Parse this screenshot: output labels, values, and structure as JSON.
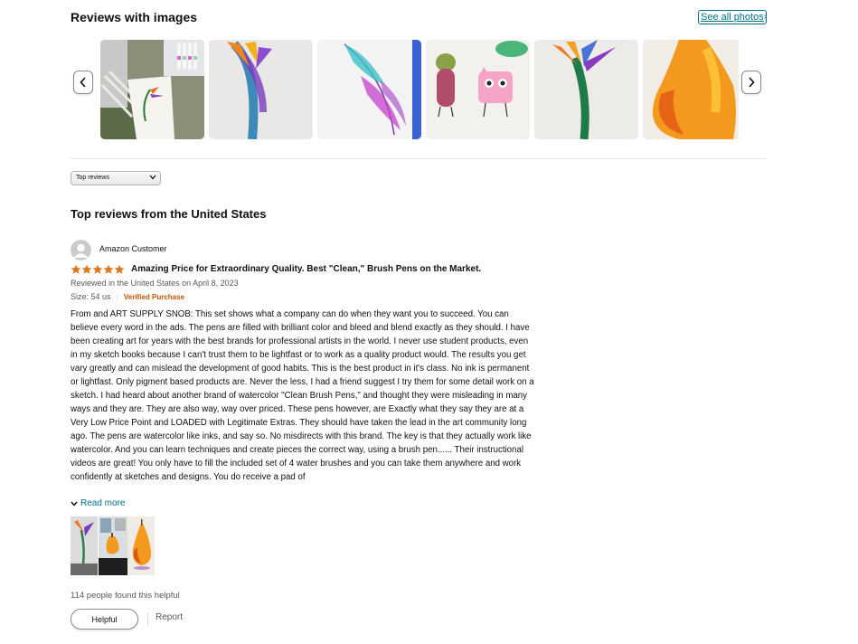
{
  "images_section": {
    "title": "Reviews with images",
    "see_all_label": "See all photos",
    "thumbnails": [
      {
        "icon": "art-supplies-photo"
      },
      {
        "icon": "bird-of-paradise-painting"
      },
      {
        "icon": "feather-painting"
      },
      {
        "icon": "cartoon-characters-drawing"
      },
      {
        "icon": "bird-of-paradise-painting"
      },
      {
        "icon": "pear-painting"
      }
    ]
  },
  "sort": {
    "selected": "Top reviews"
  },
  "reviews_heading": "Top reviews from the United States",
  "review": {
    "reviewer": "Amazon Customer",
    "rating": 5,
    "title": "Amazing Price for Extraordinary Quality. Best \"Clean,\" Brush Pens on the Market.",
    "reviewed_in": "Reviewed in the United States on April 8, 2023",
    "size": "Size: 54 us",
    "verified": "Verified Purchase",
    "body": "From and ART SUPPLY SNOB: This set shows what a company can do when they want you to succeed. You can believe every word in the ads. The pens are filled with brilliant color and bleed and blend exactly as they should. I have been creating art for years with the best brands for professional artists in the world. I never use student products, even in my sketch books because I can't trust them to be lightfast or to work as a quality product would. The results you get vary greatly and can mislead the development of good habits. This is the best product in it's class. No ink is permanent or lightfast. Only pigment based products are. Never the less, I had a friend suggest I try them for some detail work on a sketch. I had heard about another brand of watercolor \"Clean Brush Pens,\" and thought they were misleading in many ways and they are. They are also way, way over priced. These pens however, are Exactly what they say they are at a Very Low Price Point and LOADED with Legitimate Extras. They should have taken the lead in the art community long ago. The pens are watercolor like inks, and say so. No misdirects with this brand. The key is that they actually work like watercolor. And you can learn techniques and create pieces the correct way, using a brush pen...... Their instructional videos are great! You only have to fill the included set of 4 water brushes and you can take them anywhere and work confidently at sketches and designs. You do receive a pad of",
    "read_more": "Read more",
    "images": [
      {
        "icon": "bird-of-paradise-painting"
      },
      {
        "icon": "pear-in-progress-photo"
      },
      {
        "icon": "pear-painting"
      }
    ],
    "helpful_count": "114 people found this helpful",
    "helpful_label": "Helpful",
    "report_label": "Report"
  },
  "colors": {
    "link": "#007185",
    "star": "#de7921",
    "verified": "#c45500"
  }
}
